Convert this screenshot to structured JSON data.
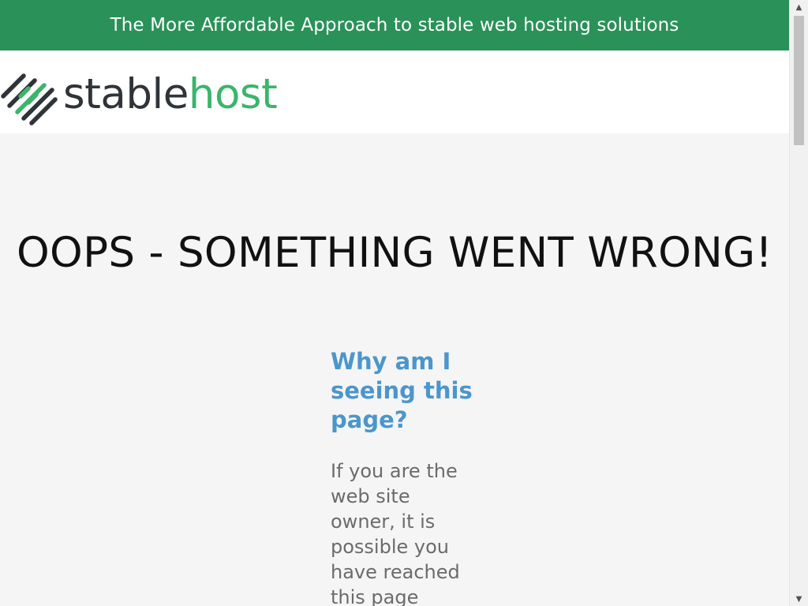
{
  "topbar": {
    "text": "The More Affordable Approach to stable web hosting solutions"
  },
  "logo": {
    "word_stable": "stable",
    "word_host": "host",
    "colors": {
      "dark": "#2f3439",
      "green": "#3bb56b"
    }
  },
  "main": {
    "headline": "OOPS - SOMETHING WENT WRONG!",
    "subhead": "Why am I seeing this page?",
    "body": "If you are the web site owner, it is possible you have reached this page"
  },
  "colors": {
    "topbar_bg": "#2a9158",
    "subhead": "#4b96cc",
    "body_text": "#6b6b6b",
    "page_bg": "#f5f5f5"
  },
  "scrollbar": {
    "up_icon": "triangle-up-icon",
    "down_icon": "triangle-down-icon"
  }
}
